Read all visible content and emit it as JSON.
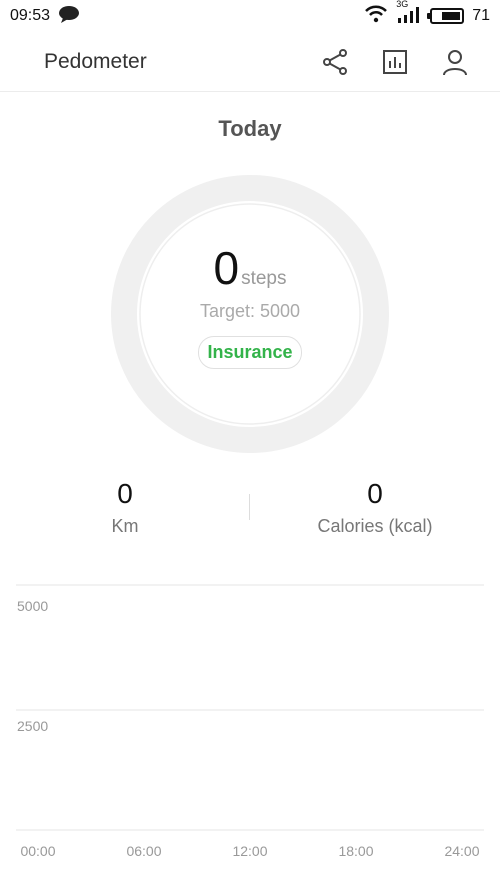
{
  "status": {
    "time": "09:53",
    "network": "3G",
    "battery": "71"
  },
  "header": {
    "title": "Pedometer"
  },
  "today": {
    "label": "Today",
    "steps_value": "0",
    "steps_unit": "steps",
    "target": "Target: 5000",
    "insurance_label": "Insurance",
    "progress": 0
  },
  "stats": {
    "distance": {
      "value": "0",
      "label": "Km"
    },
    "calories": {
      "value": "0",
      "label": "Calories (kcal)"
    }
  },
  "chart_data": {
    "type": "bar",
    "categories": [
      "00:00",
      "06:00",
      "12:00",
      "18:00",
      "24:00"
    ],
    "values": [
      0,
      0,
      0,
      0,
      0
    ],
    "yticks": [
      "5000",
      "2500"
    ],
    "ylim": [
      0,
      5000
    ],
    "title": "",
    "xlabel": "",
    "ylabel": ""
  },
  "colors": {
    "accent": "#33b34a",
    "ring": "#f0f0f0"
  }
}
